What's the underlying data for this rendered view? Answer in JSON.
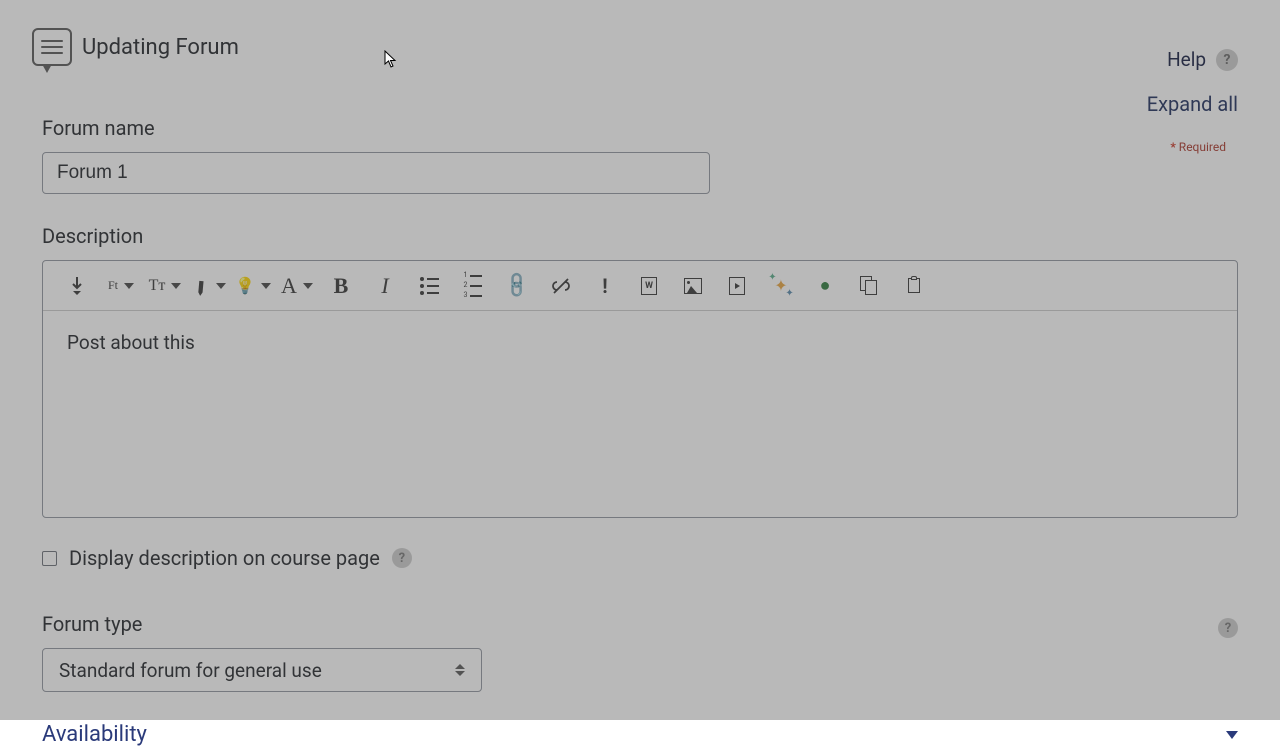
{
  "header": {
    "title": "Updating Forum",
    "help": "Help",
    "expand_all": "Expand all",
    "required_label": "Required"
  },
  "fields": {
    "forum_name_label": "Forum name",
    "forum_name_value": "Forum 1",
    "description_label": "Description",
    "description_value": "Post about this",
    "display_desc_label": "Display description on course page",
    "forum_type_label": "Forum type",
    "forum_type_value": "Standard forum for general use"
  },
  "toolbar": {
    "ft": "Ft",
    "tt": "Tт",
    "w": "W"
  },
  "sections": {
    "availability": "Availability"
  }
}
